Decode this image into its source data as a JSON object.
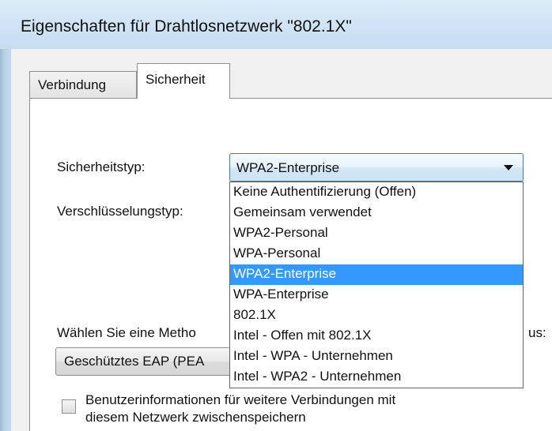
{
  "window": {
    "title": "Eigenschaften für Drahtlosnetzwerk \"802.1X\""
  },
  "tabs": [
    {
      "label": "Verbindung",
      "active": false
    },
    {
      "label": "Sicherheit",
      "active": true
    }
  ],
  "security": {
    "type_label": "Sicherheitstyp:",
    "type_value": "WPA2-Enterprise",
    "encryption_label": "Verschlüsselungstyp:",
    "dropdown_options": [
      "Keine Authentifizierung (Offen)",
      "Gemeinsam verwendet",
      "WPA2-Personal",
      "WPA-Personal",
      "WPA2-Enterprise",
      "WPA-Enterprise",
      "802.1X",
      "Intel - Offen mit 802.1X",
      "Intel - WPA - Unternehmen",
      "Intel - WPA2 - Unternehmen"
    ],
    "selected_option_index": 4
  },
  "auth": {
    "method_label_left": "Wählen Sie eine Metho",
    "method_label_right": "us:",
    "method_value": "Geschütztes EAP (PEA"
  },
  "cache": {
    "label_line1": "Benutzerinformationen für weitere Verbindungen mit",
    "label_line2": "diesem Netzwerk zwischenspeichern",
    "checked": false
  },
  "colors": {
    "highlight": "#3399ff",
    "select_border": "#3c7fb1",
    "title_bar": "#cfe3f5"
  }
}
